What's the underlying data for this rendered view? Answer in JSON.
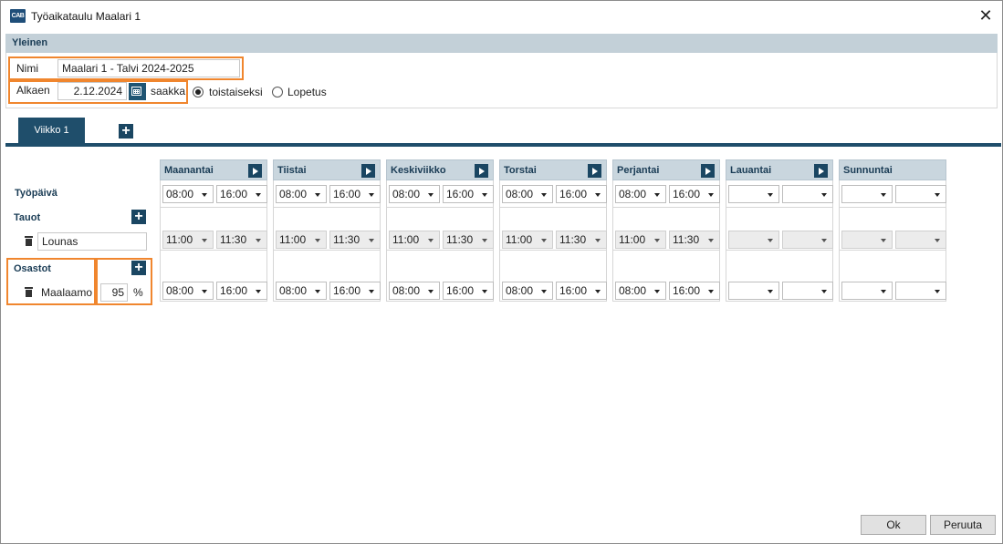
{
  "window": {
    "title": "Työaikataulu Maalari 1",
    "logo_text": "CAB"
  },
  "general": {
    "header": "Yleinen",
    "name_label": "Nimi",
    "name_value": "Maalari 1 - Talvi 2024-2025",
    "start_label": "Alkaen",
    "start_value": "2.12.2024",
    "until_label": "saakka",
    "radio_indefinite": "toistaiseksi",
    "radio_end": "Lopetus"
  },
  "tabs": {
    "week1": "Viikko 1"
  },
  "rows": {
    "workday": "Työpäivä",
    "breaks": "Tauot",
    "break_name": "Lounas",
    "departments": "Osastot",
    "dept_name": "Maalaamo",
    "dept_percent": "95",
    "percent_sign": "%"
  },
  "days": [
    {
      "name": "Maanantai",
      "work_start": "08:00",
      "work_end": "16:00",
      "break_start": "11:00",
      "break_end": "11:30",
      "dept_start": "08:00",
      "dept_end": "16:00"
    },
    {
      "name": "Tiistai",
      "work_start": "08:00",
      "work_end": "16:00",
      "break_start": "11:00",
      "break_end": "11:30",
      "dept_start": "08:00",
      "dept_end": "16:00"
    },
    {
      "name": "Keskiviikko",
      "work_start": "08:00",
      "work_end": "16:00",
      "break_start": "11:00",
      "break_end": "11:30",
      "dept_start": "08:00",
      "dept_end": "16:00"
    },
    {
      "name": "Torstai",
      "work_start": "08:00",
      "work_end": "16:00",
      "break_start": "11:00",
      "break_end": "11:30",
      "dept_start": "08:00",
      "dept_end": "16:00"
    },
    {
      "name": "Perjantai",
      "work_start": "08:00",
      "work_end": "16:00",
      "break_start": "11:00",
      "break_end": "11:30",
      "dept_start": "08:00",
      "dept_end": "16:00"
    },
    {
      "name": "Lauantai",
      "work_start": "",
      "work_end": "",
      "break_start": "",
      "break_end": "",
      "dept_start": "",
      "dept_end": ""
    },
    {
      "name": "Sunnuntai",
      "work_start": "",
      "work_end": "",
      "break_start": "",
      "break_end": "",
      "dept_start": "",
      "dept_end": ""
    }
  ],
  "buttons": {
    "ok": "Ok",
    "cancel": "Peruuta"
  },
  "colors": {
    "highlight": "#f0862e",
    "accent": "#1f4e6b",
    "header_bg": "#c3d0d8"
  }
}
